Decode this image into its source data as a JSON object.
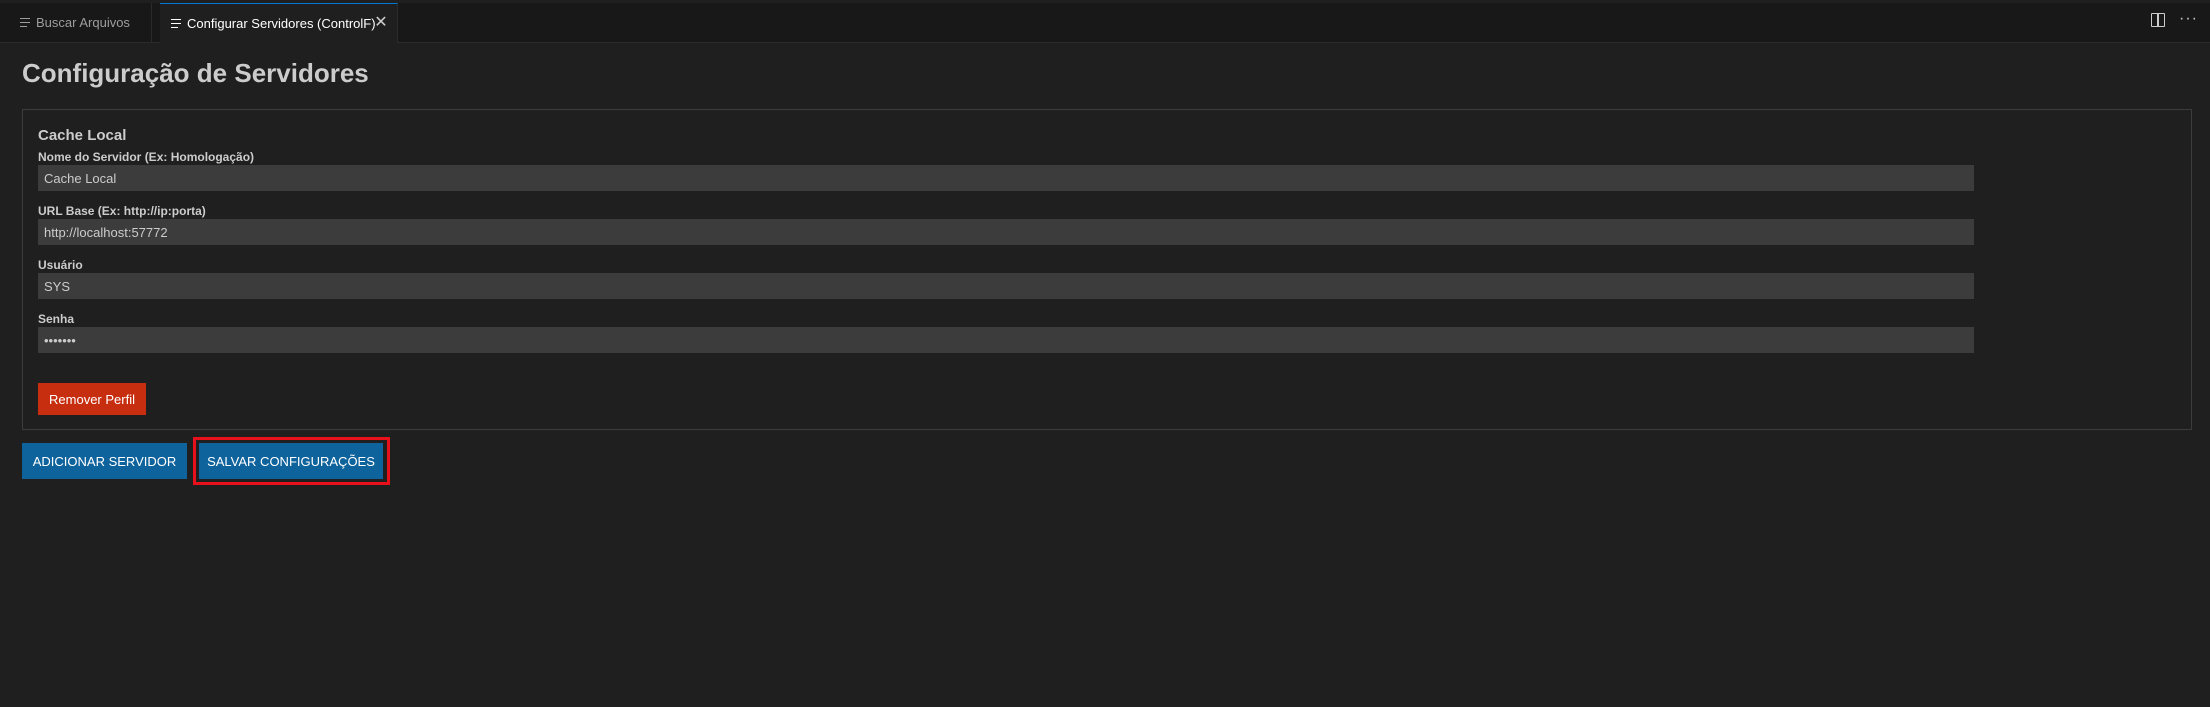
{
  "tabs": [
    {
      "label": "Buscar Arquivos",
      "active": false
    },
    {
      "label": "Configurar Servidores (ControlF)",
      "active": true
    }
  ],
  "editor_actions": {
    "split_icon": "split-editor-icon",
    "more_icon": "more-actions-icon",
    "more_glyph": "···"
  },
  "page": {
    "title": "Configuração de Servidores"
  },
  "server": {
    "title": "Cache Local",
    "fields": {
      "name": {
        "label": "Nome do Servidor (Ex: Homologação)",
        "value": "Cache Local"
      },
      "url": {
        "label": "URL Base (Ex: http://ip:porta)",
        "value": "http://localhost:57772"
      },
      "user": {
        "label": "Usuário",
        "value": "SYS"
      },
      "password": {
        "label": "Senha",
        "value": "•••••••"
      }
    },
    "remove_label": "Remover Perfil"
  },
  "actions": {
    "add_label": "ADICIONAR SERVIDOR",
    "save_label": "SALVAR CONFIGURAÇÕES"
  },
  "colors": {
    "accent": "#0e639c",
    "danger": "#c72e0f",
    "highlight": "#e8101a",
    "background": "#1f1f1f"
  }
}
